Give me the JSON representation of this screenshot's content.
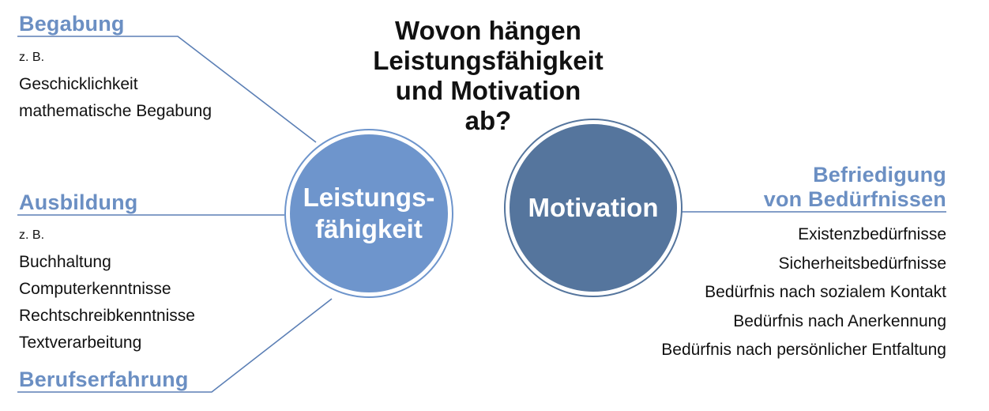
{
  "question": [
    "Wovon hängen",
    "Leistungsfähigkeit",
    "und Motivation",
    "ab?"
  ],
  "left": {
    "sections": [
      {
        "heading": "Begabung",
        "prefix": "z. B.",
        "items": [
          "Geschicklichkeit",
          "mathematische Begabung"
        ]
      },
      {
        "heading": "Ausbildung",
        "prefix": "z. B.",
        "items": [
          "Buchhaltung",
          "Computerkenntnisse",
          "Rechtschreibkenntnisse",
          "Textverarbeitung"
        ]
      },
      {
        "heading": "Berufserfahrung"
      }
    ]
  },
  "circles": {
    "leistung": {
      "line1": "Leistungs-",
      "line2": "fähigkeit"
    },
    "motivation": {
      "label": "Motivation"
    }
  },
  "right": {
    "heading": [
      "Befriedigung",
      "von Bedürfnissen"
    ],
    "items": [
      "Existenzbedürfnisse",
      "Sicherheitsbedürfnisse",
      "Bedürfnis nach sozialem Kontakt",
      "Bedürfnis nach Anerkennung",
      "Bedürfnis nach persönlicher Entfaltung"
    ]
  },
  "colors": {
    "accent": "#6b8fc3",
    "circle_light": "#6e95cc",
    "circle_dark": "#55759d",
    "line": "#5b7fb5"
  }
}
